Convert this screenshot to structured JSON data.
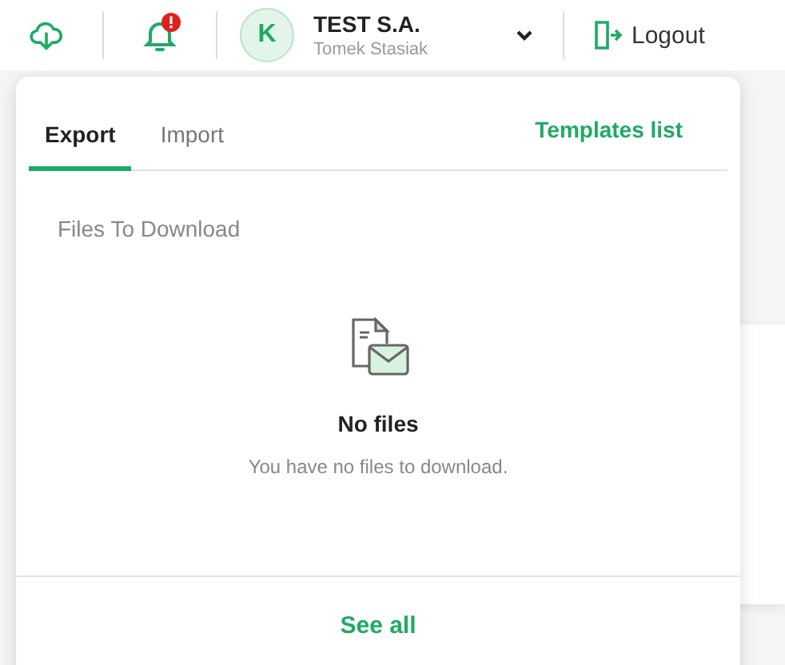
{
  "header": {
    "avatar_initial": "K",
    "company": "TEST S.A.",
    "user": "Tomek Stasiak",
    "notification_alert": true,
    "logout": "Logout"
  },
  "panel": {
    "tabs": [
      {
        "label": "Export",
        "selected": true
      },
      {
        "label": "Import",
        "selected": false
      }
    ],
    "templates_link": "Templates list",
    "section_title": "Files To Download",
    "empty": {
      "title": "No files",
      "message": "You have no files to download."
    },
    "see_all": "See all"
  }
}
